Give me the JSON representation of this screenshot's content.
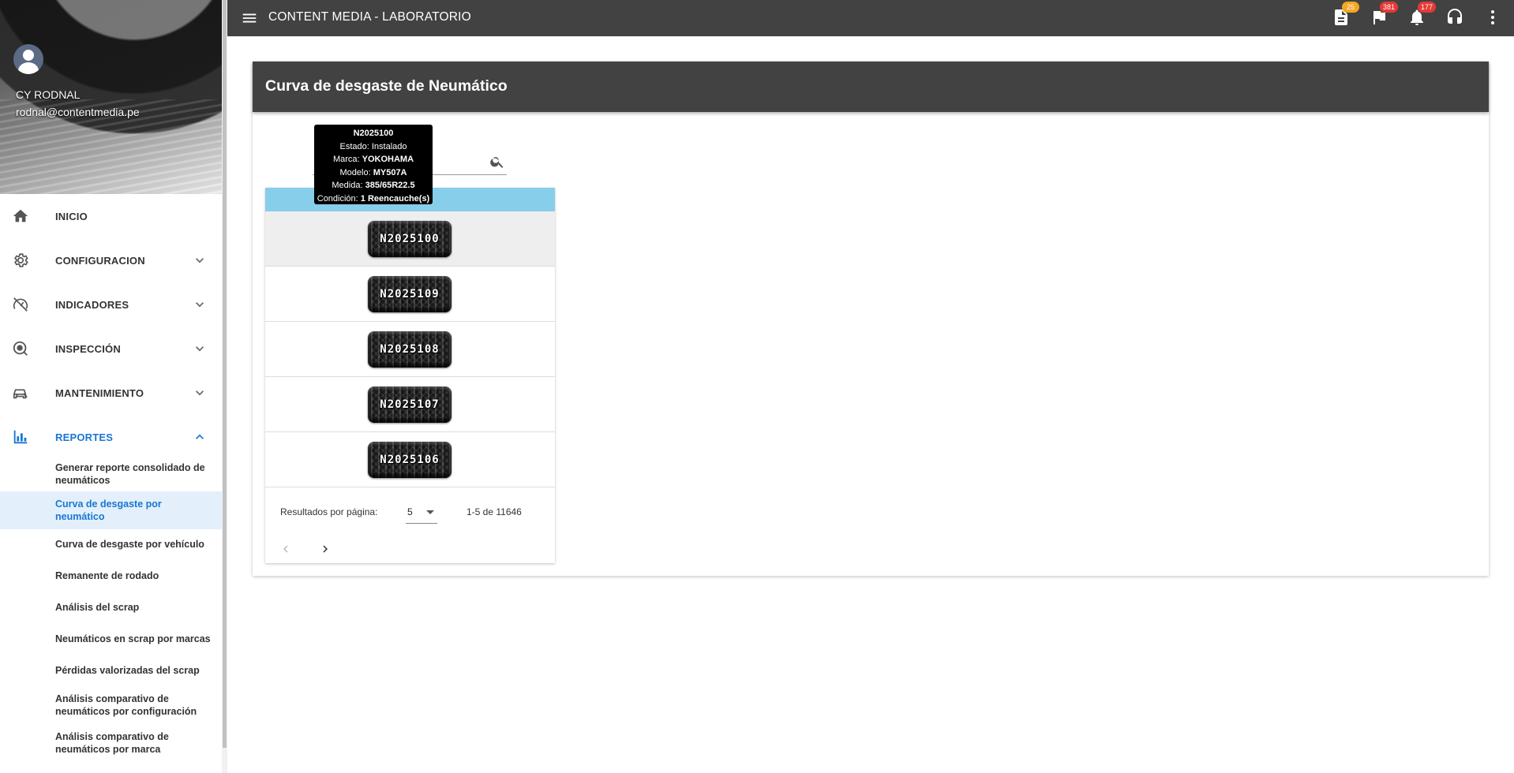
{
  "app": {
    "title": "CONTENT MEDIA - LABORATORIO"
  },
  "user": {
    "name": "CY RODNAL",
    "email": "rodnal@contentmedia.pe"
  },
  "topbar": {
    "badges": {
      "documents": "25",
      "flags": "381",
      "notifications": "177"
    },
    "badge_colors": {
      "documents": "#f5a623",
      "flags": "#e53935",
      "notifications": "#e53935"
    }
  },
  "sidebar": {
    "items": [
      {
        "label": "INICIO",
        "icon": "home-icon"
      },
      {
        "label": "CONFIGURACION",
        "icon": "gear-icon"
      },
      {
        "label": "INDICADORES",
        "icon": "speedometer-icon"
      },
      {
        "label": "INSPECCIÓN",
        "icon": "inspection-icon"
      },
      {
        "label": "MANTENIMIENTO",
        "icon": "car-repair-icon"
      },
      {
        "label": "REPORTES",
        "icon": "bar-chart-icon"
      }
    ],
    "reports": [
      "Generar reporte consolidado de neumáticos",
      "Curva de desgaste por neumático",
      "Curva de desgaste por vehículo",
      "Remanente de rodado",
      "Análisis del scrap",
      "Neumáticos en scrap por marcas",
      "Pérdidas valorizadas del scrap",
      "Análisis comparativo de neumáticos por configuración",
      "Análisis comparativo de neumáticos por marca"
    ],
    "accent_color": "#1976d2"
  },
  "page": {
    "title": "Curva de desgaste de Neumático",
    "search": {
      "value": "",
      "placeholder": ""
    },
    "tires": [
      "N2025100",
      "N2025109",
      "N2025108",
      "N2025107",
      "N2025106"
    ],
    "pagination": {
      "label": "Resultados por página:",
      "per_page": "5",
      "range": "1-5 de 11646"
    },
    "header_color": "#87ceeb"
  },
  "tooltip": {
    "code": "N2025100",
    "estado_label": "Estado:",
    "estado": "Instalado",
    "marca_label": "Marca:",
    "marca": "YOKOHAMA",
    "modelo_label": "Modelo:",
    "modelo": "MY507A",
    "medida_label": "Medida:",
    "medida": "385/65R22.5",
    "condicion_label": "Condición:",
    "condicion": "1 Reencauche(s)"
  }
}
